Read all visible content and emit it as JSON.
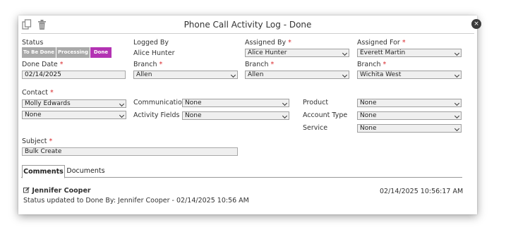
{
  "dialog": {
    "title": "Phone Call Activity Log - Done"
  },
  "toolbar": {
    "copy_icon": "copy-icon",
    "delete_icon": "trash-icon"
  },
  "status": {
    "label": "Status",
    "options": [
      "To Be Done",
      "Processing",
      "Done"
    ],
    "colors": {
      "to_be_done": "#a9a9a9",
      "processing": "#a9a9a9",
      "done": "#b333b3"
    }
  },
  "logged_by": {
    "label": "Logged By",
    "value": "Alice Hunter"
  },
  "assigned_by": {
    "label": "Assigned By",
    "value": "Alice Hunter"
  },
  "assigned_for": {
    "label": "Assigned For",
    "value": "Everett Martin"
  },
  "done_date": {
    "label": "Done Date",
    "value": "02/14/2025"
  },
  "branch_logged": {
    "label": "Branch",
    "value": "Allen"
  },
  "branch_assigned_by": {
    "label": "Branch",
    "value": "Allen"
  },
  "branch_assigned_for": {
    "label": "Branch",
    "value": "Wichita West"
  },
  "contact": {
    "label": "Contact",
    "value": "Molly Edwards",
    "secondary": "None"
  },
  "communication": {
    "label": "Communication",
    "value": "None"
  },
  "activity_fields": {
    "label": "Activity Fields",
    "value": "None"
  },
  "product": {
    "label": "Product",
    "value": "None"
  },
  "account_type": {
    "label": "Account Type",
    "value": "None"
  },
  "service": {
    "label": "Service",
    "value": "None"
  },
  "subject": {
    "label": "Subject",
    "value": "Bulk Create"
  },
  "tabs": [
    {
      "label": "Comments",
      "active": true
    },
    {
      "label": "Documents",
      "active": false
    }
  ],
  "comment": {
    "author": "Jennifer Cooper",
    "timestamp": "02/14/2025 10:56:17 AM",
    "text": "Status updated to Done By: Jennifer Cooper - 02/14/2025 10:56 AM"
  },
  "required_marker": "*",
  "close_glyph": "×"
}
